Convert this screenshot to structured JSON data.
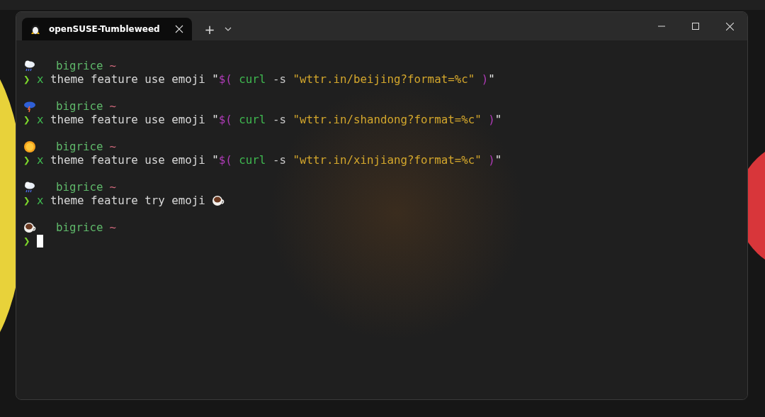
{
  "tabs": [
    {
      "title": "openSUSE-Tumbleweed",
      "selected": true
    }
  ],
  "new_tab": "+",
  "blocks": [
    {
      "kind": "rain",
      "user": "bigrice",
      "path": "~",
      "arrow": "❯",
      "words": [
        [
          {
            "kind": "cmd",
            "text": "x"
          }
        ],
        [
          {
            "kind": "plain",
            "text": "theme feature use emoji"
          }
        ],
        [
          {
            "kind": "quote",
            "text": "\""
          },
          {
            "kind": "sub",
            "text": "$("
          }
        ],
        [
          {
            "kind": "cmd",
            "text": "curl"
          }
        ],
        [
          {
            "kind": "flag",
            "text": "-s"
          }
        ],
        [
          {
            "kind": "string",
            "text": "\"wttr.in/beijing?format=%c\""
          }
        ],
        [
          {
            "kind": "sub",
            "text": ")"
          },
          {
            "kind": "quote",
            "text": "\""
          }
        ]
      ]
    },
    {
      "kind": "storm",
      "user": "bigrice",
      "path": "~",
      "arrow": "❯",
      "words": [
        [
          {
            "kind": "cmd",
            "text": "x"
          }
        ],
        [
          {
            "kind": "plain",
            "text": "theme feature use emoji"
          }
        ],
        [
          {
            "kind": "quote",
            "text": "\""
          },
          {
            "kind": "sub",
            "text": "$("
          }
        ],
        [
          {
            "kind": "cmd",
            "text": "curl"
          }
        ],
        [
          {
            "kind": "flag",
            "text": "-s"
          }
        ],
        [
          {
            "kind": "string",
            "text": "\"wttr.in/shandong?format=%c\""
          }
        ],
        [
          {
            "kind": "sub",
            "text": ")"
          },
          {
            "kind": "quote",
            "text": "\""
          }
        ]
      ]
    },
    {
      "kind": "sun",
      "user": "bigrice",
      "path": "~",
      "arrow": "❯",
      "words": [
        [
          {
            "kind": "cmd",
            "text": "x"
          }
        ],
        [
          {
            "kind": "plain",
            "text": "theme feature use emoji"
          }
        ],
        [
          {
            "kind": "quote",
            "text": "\""
          },
          {
            "kind": "sub",
            "text": "$("
          }
        ],
        [
          {
            "kind": "cmd",
            "text": "curl"
          }
        ],
        [
          {
            "kind": "flag",
            "text": "-s"
          }
        ],
        [
          {
            "kind": "string",
            "text": "\"wttr.in/xinjiang?format=%c\""
          }
        ],
        [
          {
            "kind": "sub",
            "text": ")"
          },
          {
            "kind": "quote",
            "text": "\""
          }
        ]
      ]
    },
    {
      "kind": "rain",
      "user": "bigrice",
      "path": "~",
      "arrow": "❯",
      "words": [
        [
          {
            "kind": "cmd",
            "text": "x"
          }
        ],
        [
          {
            "kind": "plain",
            "text": "theme feature try emoji"
          }
        ],
        [
          {
            "kind": "coffee"
          }
        ]
      ]
    },
    {
      "kind": "coffee",
      "user": "bigrice",
      "path": "~",
      "arrow": "❯",
      "cursor": true
    }
  ]
}
